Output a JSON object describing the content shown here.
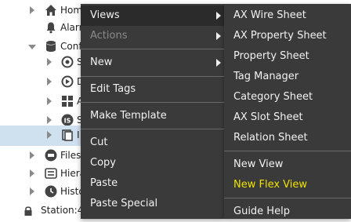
{
  "tree": {
    "rows": [
      {
        "label": "Home"
      },
      {
        "label": "Alarm"
      },
      {
        "label": "Config"
      },
      {
        "label": "S"
      },
      {
        "label": "D"
      },
      {
        "label": "A"
      },
      {
        "label": "S"
      },
      {
        "label": "I"
      },
      {
        "label": "Files"
      },
      {
        "label": "Hiera"
      },
      {
        "label": "Histo"
      },
      {
        "label": "Station:49"
      }
    ]
  },
  "context_menu": {
    "items": [
      {
        "label": "Views"
      },
      {
        "label": "Actions"
      },
      {
        "label": "New"
      },
      {
        "label": "Edit Tags"
      },
      {
        "label": "Make Template"
      },
      {
        "label": "Cut"
      },
      {
        "label": "Copy"
      },
      {
        "label": "Paste"
      },
      {
        "label": "Paste Special"
      }
    ]
  },
  "views_submenu": {
    "items": [
      {
        "label": "AX Wire Sheet"
      },
      {
        "label": "AX Property Sheet"
      },
      {
        "label": "Property Sheet"
      },
      {
        "label": "Tag Manager"
      },
      {
        "label": "Category Sheet"
      },
      {
        "label": "AX Slot Sheet"
      },
      {
        "label": "Relation Sheet"
      },
      {
        "label": "New View"
      },
      {
        "label": "New Flex View"
      },
      {
        "label": "Guide Help"
      }
    ]
  },
  "colors": {
    "menu_bg": "#3a3a3a",
    "menu_highlight": "#2b2b2b",
    "accent_text": "#f0e200",
    "selection": "#cfe0ee"
  }
}
